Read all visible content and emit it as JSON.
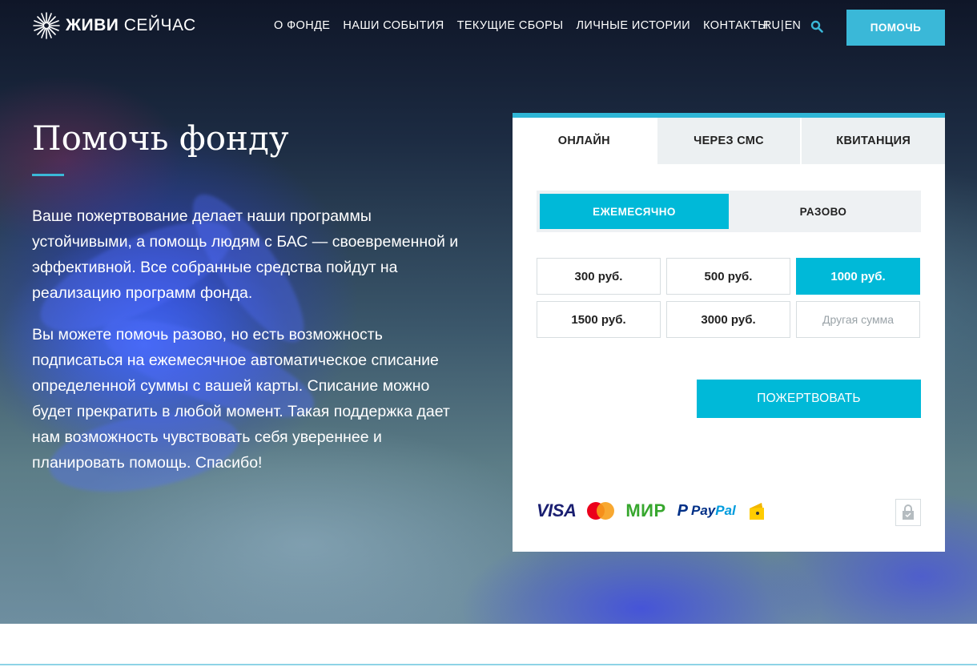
{
  "header": {
    "logo_bold": "ЖИВИ",
    "logo_light": "СЕЙЧАС",
    "nav": [
      "О ФОНДЕ",
      "НАШИ СОБЫТИЯ",
      "ТЕКУЩИЕ СБОРЫ",
      "ЛИЧНЫЕ ИСТОРИИ",
      "КОНТАКТЫ"
    ],
    "lang_ru": "RU",
    "lang_sep": "|",
    "lang_en": "EN",
    "help_button": "ПОМОЧЬ"
  },
  "hero": {
    "title": "Помочь фонду",
    "paragraph1": "Ваше пожертвование делает наши программы устойчивыми, а помощь людям с БАС — своевременной и эффективной. Все собранные средства пойдут на реализацию программ фонда.",
    "paragraph2": "Вы можете помочь разово, но есть возможность подписаться на ежемесячное автоматическое списание определенной суммы с вашей карты. Списание можно будет прекратить в любой момент. Такая поддержка дает нам возможность чувствовать себя увереннее и планировать помощь. Спасибо!"
  },
  "donation": {
    "tabs": [
      "ОНЛАЙН",
      "ЧЕРЕЗ СМС",
      "КВИТАНЦИЯ"
    ],
    "active_tab": 0,
    "frequency": [
      "ЕЖЕМЕСЯЧНО",
      "РАЗОВО"
    ],
    "active_frequency": 0,
    "amounts": [
      "300 руб.",
      "500 руб.",
      "1000 руб.",
      "1500 руб.",
      "3000 руб."
    ],
    "active_amount": 2,
    "custom_placeholder": "Другая сумма",
    "custom_value": "",
    "donate_button": "ПОЖЕРТВОВАТЬ",
    "payment_logos": {
      "visa": "VISA",
      "mir": "МИР",
      "paypal_a": "Pay",
      "paypal_b": "Pal"
    },
    "accent_color": "#00b9d8"
  },
  "icons": [
    "logo-flower-icon",
    "search-icon",
    "mastercard-icon",
    "paypal-icon",
    "yandex-money-icon",
    "lock-icon"
  ]
}
